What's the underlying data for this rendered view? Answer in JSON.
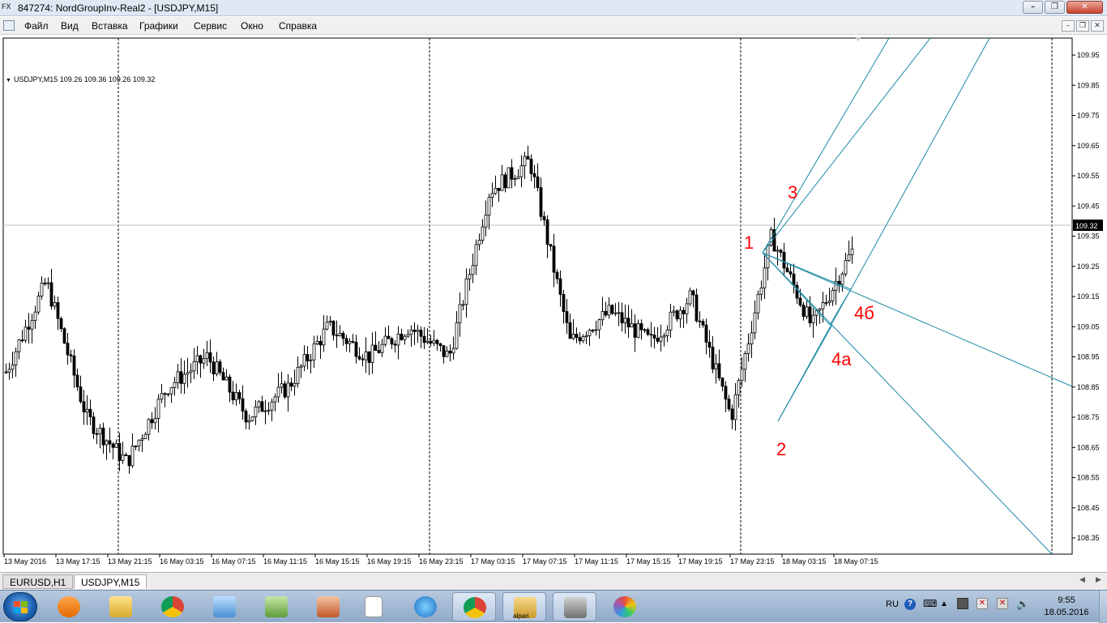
{
  "window": {
    "title": "847274: NordGroupInv-Real2 - [USDJPY,M15]",
    "app_icon_text": "FX"
  },
  "menu": {
    "items": [
      "Файл",
      "Вид",
      "Вставка",
      "Графики",
      "Сервис",
      "Окно",
      "Справка"
    ]
  },
  "chart": {
    "symbol_info": "USDJPY,M15  109.26 109.36 109.26 109.32",
    "current_price_label": "109.32",
    "price_axis": [
      "109.95",
      "109.85",
      "109.75",
      "109.65",
      "109.55",
      "109.45",
      "109.35",
      "109.25",
      "109.15",
      "109.05",
      "108.95",
      "108.85",
      "108.75",
      "108.65",
      "108.55",
      "108.45",
      "108.35"
    ],
    "time_axis": [
      "13 May 2016",
      "13 May 17:15",
      "13 May 21:15",
      "16 May 03:15",
      "16 May 07:15",
      "16 May 11:15",
      "16 May 15:15",
      "16 May 19:15",
      "16 May 23:15",
      "17 May 03:15",
      "17 May 07:15",
      "17 May 11:15",
      "17 May 15:15",
      "17 May 19:15",
      "17 May 23:15",
      "18 May 03:15",
      "18 May 07:15"
    ],
    "wave_labels": [
      "1",
      "2",
      "3",
      "4a",
      "4б"
    ],
    "colors": {
      "candles": "#000000",
      "trendlines": "#1b8aa5",
      "wave_labels": "#ff0000",
      "price_line": "#c0c0c0"
    }
  },
  "chart_data": {
    "type": "candlestick",
    "symbol": "USDJPY",
    "timeframe": "M15",
    "ylim": [
      108.3,
      110.0
    ],
    "x": [
      "13 May 2016",
      "13 May 17:15",
      "13 May 21:15",
      "16 May 03:15",
      "16 May 07:15",
      "16 May 11:15",
      "16 May 15:15",
      "16 May 19:15",
      "16 May 23:15",
      "17 May 03:15",
      "17 May 07:15",
      "17 May 11:15",
      "17 May 15:15",
      "17 May 19:15",
      "17 May 23:15",
      "18 May 03:15",
      "18 May 07:15"
    ],
    "close_path": [
      108.9,
      109.2,
      108.75,
      108.6,
      108.85,
      108.95,
      108.75,
      108.85,
      109.05,
      108.95,
      109.05,
      108.95,
      109.5,
      109.6,
      109.0,
      109.1,
      109.0,
      109.15,
      108.75,
      109.35,
      109.05,
      109.3
    ]
  },
  "tabs": [
    "EURUSD,H1",
    "USDJPY,M15"
  ],
  "taskbar": {
    "language": "RU",
    "time": "9:55",
    "date": "18.05.2016",
    "apps": [
      "media-player-icon",
      "file-explorer-icon",
      "chrome-icon",
      "control-panel-icon",
      "users-icon",
      "speaker-icon",
      "document-icon",
      "internet-explorer-icon",
      "chrome-icon",
      "alpari-icon",
      "fx-terminal-icon",
      "paint-icon"
    ],
    "alpari_label": "alpari"
  }
}
